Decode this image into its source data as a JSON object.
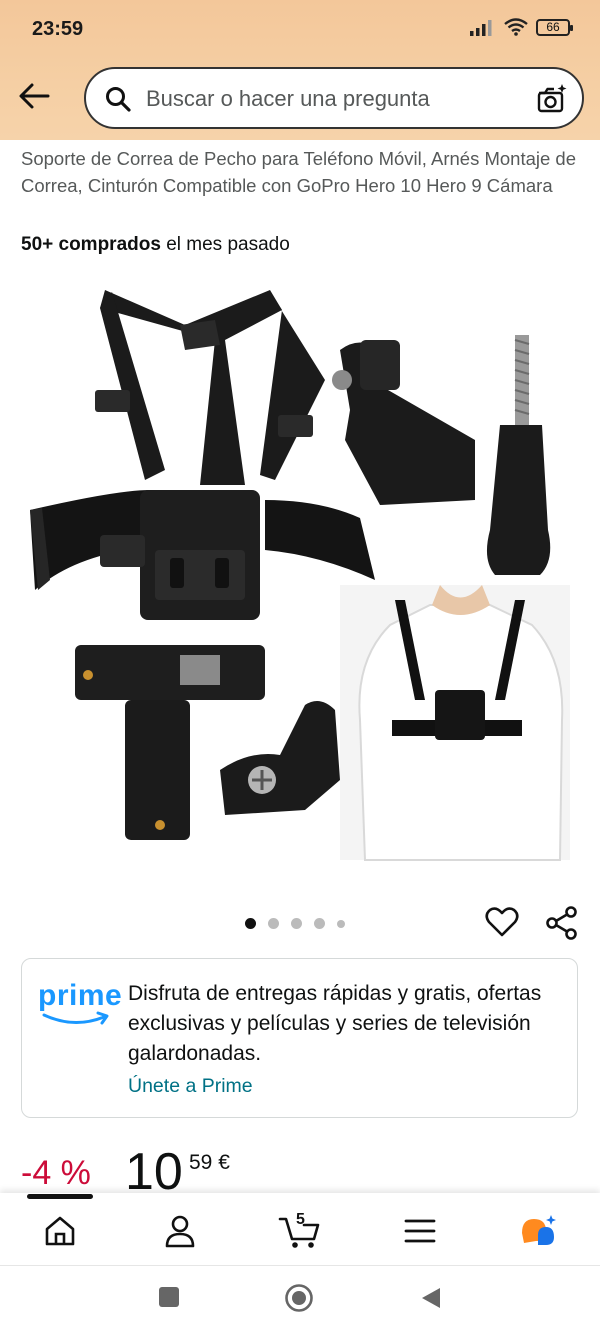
{
  "status_bar": {
    "time": "23:59",
    "battery_level": "66"
  },
  "search": {
    "placeholder": "Buscar o hacer una pregunta"
  },
  "product": {
    "title": "Soporte de Correa de Pecho para Teléfono Móvil, Arnés Montaje de Correa, Cinturón Compatible con GoPro Hero 10 Hero 9 Cámara",
    "purchases_bold": "50+ comprados",
    "purchases_rest": " el mes pasado",
    "image_count": 5,
    "active_image_index": 0
  },
  "prime": {
    "logo": "prime",
    "message": "Disfruta de entregas rápidas y gratis, ofertas exclusivas y películas y series de televisión galardonadas.",
    "link": "Únete a Prime"
  },
  "price": {
    "discount": "-4 %",
    "whole": "10",
    "fraction": "59",
    "currency": "€"
  },
  "bottom_nav": {
    "items": [
      "home",
      "account",
      "cart",
      "menu",
      "assistant"
    ],
    "cart_count": "5"
  },
  "colors": {
    "header_bg": "#f3c79a",
    "prime_blue": "#1a98ff",
    "link_teal": "#007185",
    "discount_red": "#cc0c39",
    "assistant_orange": "#ff8a1f",
    "assistant_blue": "#1a73e8"
  }
}
